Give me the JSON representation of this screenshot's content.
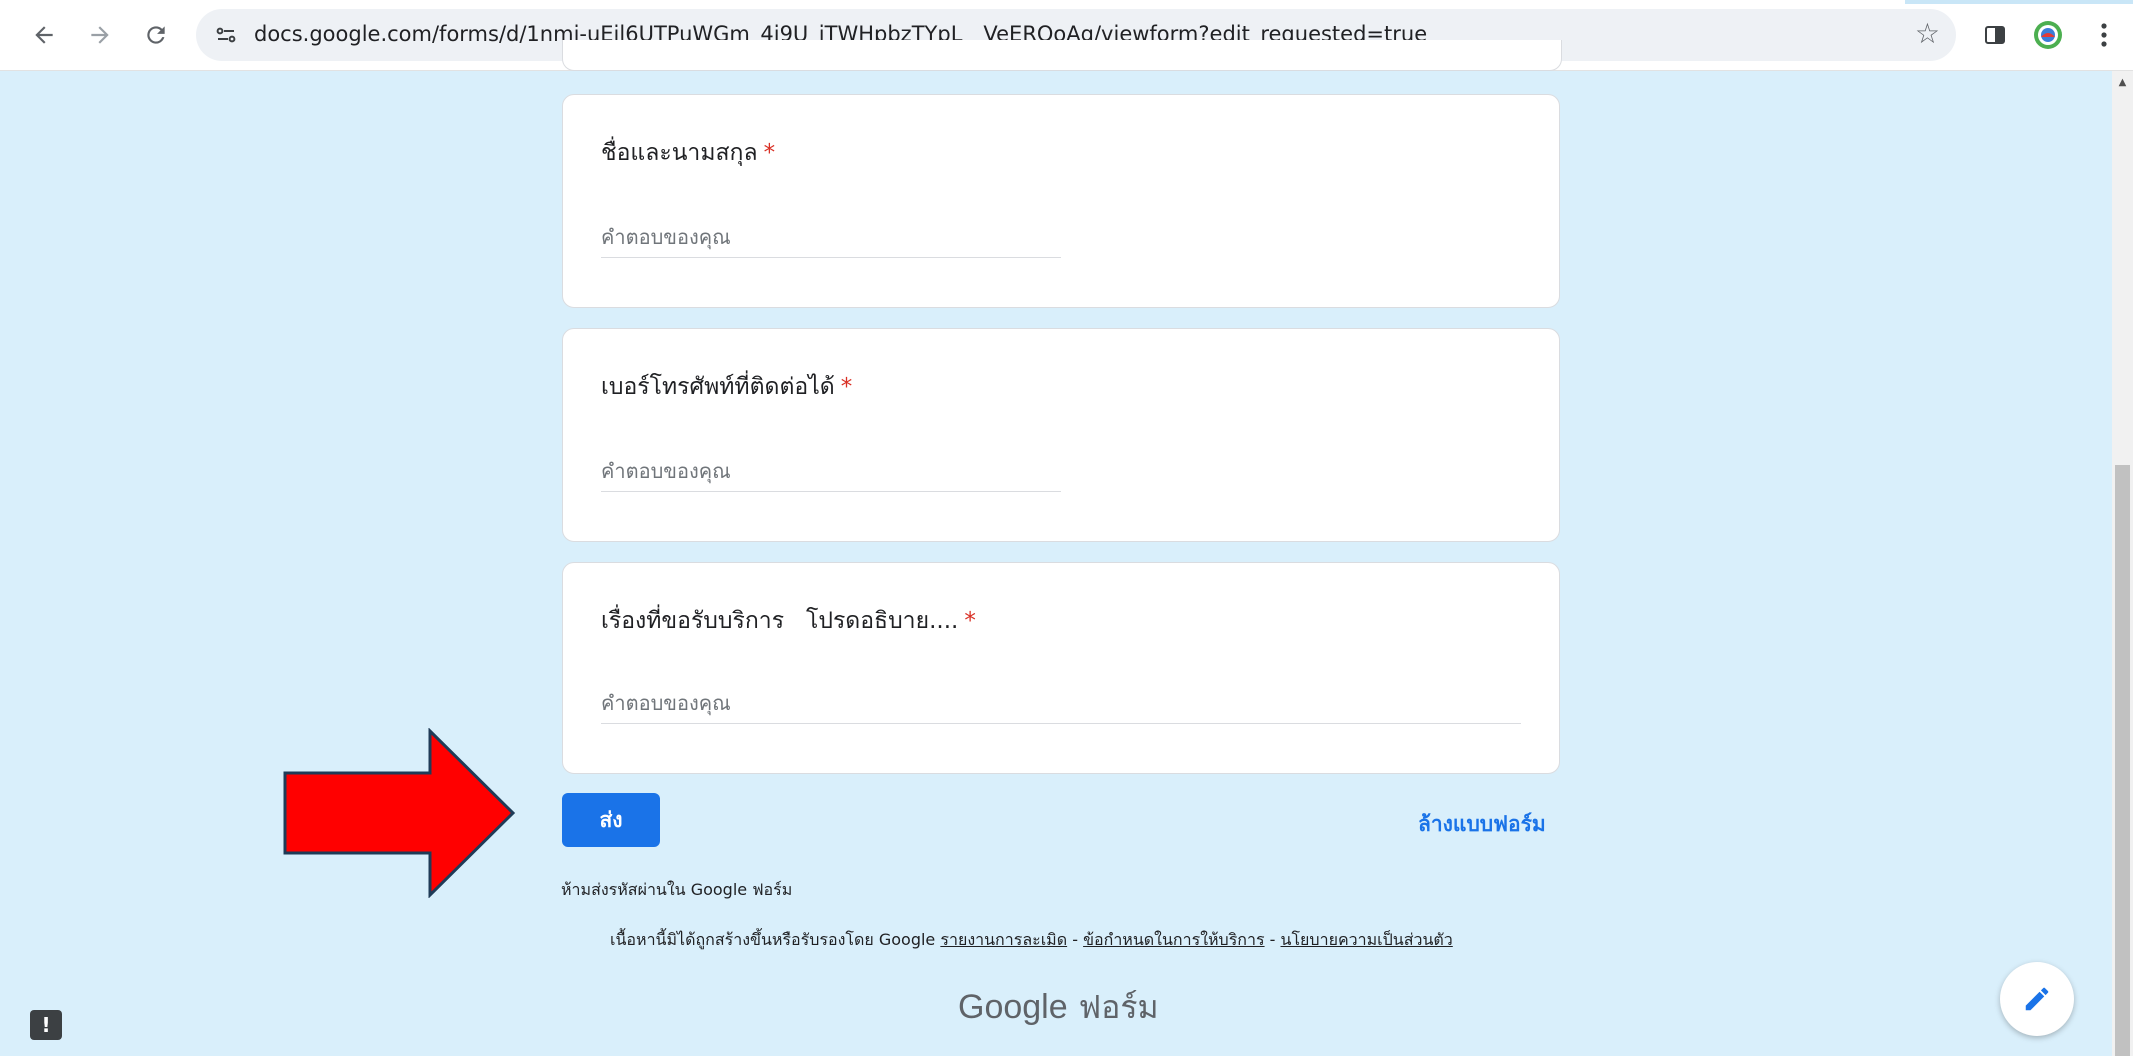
{
  "browser": {
    "url": "docs.google.com/forms/d/1nmj-uEil6UTPuWGm_4i9U_iTWHpbzTYpL__VeERQoAg/viewform?edit_requested=true",
    "back_icon": "arrow-left-icon",
    "forward_icon": "arrow-right-icon",
    "reload_icon": "reload-icon",
    "star_icon": "star-icon",
    "sidepanel_icon": "side-panel-icon",
    "profile_icon": "profile-avatar-icon",
    "menu_icon": "kebab-menu-icon"
  },
  "form": {
    "questions": [
      {
        "title": "ชื่อและนามสกุล",
        "required": "*",
        "placeholder": "คำตอบของคุณ"
      },
      {
        "title": "เบอร์โทรศัพท์ที่ติดต่อได้",
        "required": "*",
        "placeholder": "คำตอบของคุณ"
      },
      {
        "title": "เรื่องที่ขอรับบริการ   โปรดอธิบาย....",
        "required": "*",
        "placeholder": "คำตอบของคุณ"
      }
    ],
    "submit_label": "ส่ง",
    "clear_label": "ล้างแบบฟอร์ม",
    "password_note": "ห้ามส่งรหัสผ่านใน Google ฟอร์ม",
    "footer": {
      "prefix": "เนื้อหานี้มิได้ถูกสร้างขึ้นหรือรับรองโดย Google",
      "report_link": "รายงานการละเมิด",
      "sep1": " - ",
      "terms_link": "ข้อกำหนดในการให้บริการ",
      "sep2": " - ",
      "privacy_link": "นโยบายความเป็นส่วนตัว"
    },
    "brand_google": "Google",
    "brand_forms": "ฟอร์ม"
  },
  "colors": {
    "page_bg": "#d9effb",
    "accent": "#1a73e8",
    "required": "#d93025",
    "annotation_arrow": "#ff0000"
  }
}
